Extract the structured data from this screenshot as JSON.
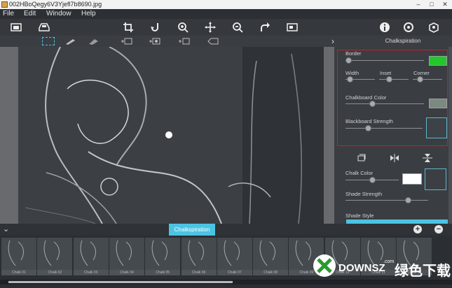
{
  "window": {
    "title": "002HBoQegy6V3Yjefl7b8690.jpg",
    "minimize": "–",
    "maximize": "□",
    "close": "✕"
  },
  "menu": [
    "File",
    "Edit",
    "Window",
    "Help"
  ],
  "toolbar": {
    "left_icons": [
      "image-icon",
      "open-tray-icon"
    ],
    "center_icons": [
      "crop-icon",
      "rotate-icon",
      "zoom-in-icon",
      "move-icon",
      "zoom-out-icon",
      "redo-icon",
      "fit-screen-icon"
    ],
    "right_icons": [
      "info-icon",
      "settings-icon",
      "share-icon"
    ]
  },
  "subtoolbar": {
    "icons": [
      "rect-select-icon",
      "brush-icon",
      "eraser-icon",
      "add-layer-icon",
      "add-mask-icon",
      "add-frame-icon",
      "clear-icon"
    ],
    "expand_glyph": "›",
    "panel_title": "Chalkspiration"
  },
  "panel": {
    "border_label": "Border",
    "border_color": "#22c72a",
    "width_label": "Width",
    "inset_label": "Inset",
    "corner_label": "Corner",
    "chalkboard_color_label": "Chalkboard Color",
    "chalkboard_color": "#7b8a7e",
    "blackboard_strength_label": "Blackboard Strength",
    "chalk_color_label": "Chalk Color",
    "chalk_color": "#ffffff",
    "shade_strength_label": "Shade Strength",
    "shade_style_label": "Shade Style",
    "controls": {
      "border": 0.0,
      "width": 0.05,
      "inset": 0.5,
      "corner": 0.5,
      "chalkboard_color": 0.3,
      "blackboard_strength": 0.25,
      "chalk_color": 0.45,
      "shade_strength": 0.85
    }
  },
  "bottom": {
    "tab_label": "Chalkspiration",
    "add": "+",
    "remove": "−",
    "collapse": "⌄"
  },
  "thumbnails": [
    "Chalk 01",
    "Chalk 02",
    "Chalk 03",
    "Chalk 04",
    "Chalk 05",
    "Chalk 06",
    "Chalk 07",
    "Chalk 08",
    "Chalk 09",
    "Chalk 10",
    "Chalk 11",
    "Chalk 12"
  ],
  "watermark": {
    "text": "DOWNSZ",
    "suffix": ".com",
    "cn": "绿色下载"
  }
}
